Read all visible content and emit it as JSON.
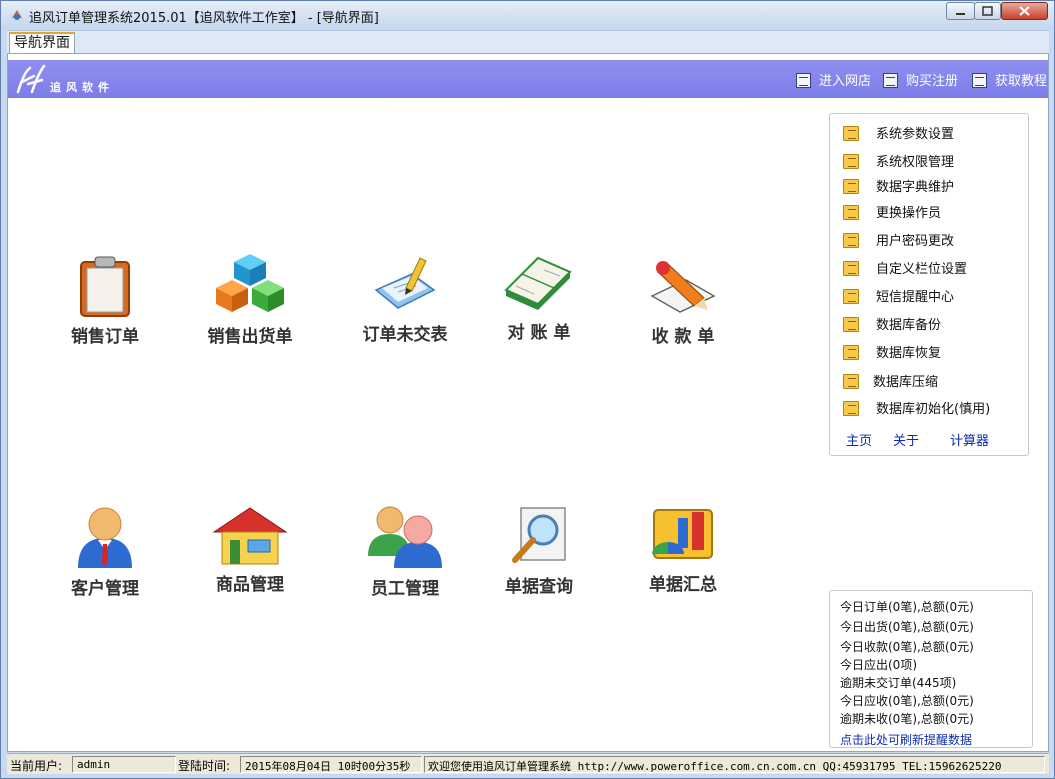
{
  "window": {
    "title": "追风订单管理系统2015.01【追风软件工作室】 - [导航界面]"
  },
  "tabs": [
    {
      "label": "导航界面"
    }
  ],
  "banner": {
    "logo_text": "追风软件",
    "links": [
      {
        "label": "进入网店"
      },
      {
        "label": "购买注册"
      },
      {
        "label": "获取教程"
      }
    ]
  },
  "modules": [
    {
      "label": "销售订单",
      "icon": "clipboard-icon"
    },
    {
      "label": "销售出货单",
      "icon": "cubes-icon"
    },
    {
      "label": "订单未交表",
      "icon": "note-pencil-icon"
    },
    {
      "label": "对 账 单",
      "icon": "open-book-icon"
    },
    {
      "label": "收 款 单",
      "icon": "pen-paper-icon"
    },
    {
      "label": "客户管理",
      "icon": "customer-icon"
    },
    {
      "label": "商品管理",
      "icon": "house-icon"
    },
    {
      "label": "员工管理",
      "icon": "staff-icon"
    },
    {
      "label": "单据查询",
      "icon": "magnifier-icon"
    },
    {
      "label": "单据汇总",
      "icon": "summary-chart-icon"
    }
  ],
  "settings": {
    "items": [
      {
        "label": "系统参数设置"
      },
      {
        "label": "系统权限管理"
      },
      {
        "label": "数据字典维护"
      },
      {
        "label": "更换操作员"
      },
      {
        "label": "用户密码更改"
      },
      {
        "label": "自定义栏位设置"
      },
      {
        "label": "短信提醒中心"
      },
      {
        "label": "数据库备份"
      },
      {
        "label": "数据库恢复"
      },
      {
        "label": "数据库压缩"
      },
      {
        "label": "数据库初始化(慎用)"
      }
    ],
    "links": [
      {
        "label": "主页"
      },
      {
        "label": "关于"
      },
      {
        "label": "计算器"
      }
    ]
  },
  "reminders": {
    "lines": [
      "今日订单(0笔),总额(0元)",
      "今日出货(0笔),总额(0元)",
      "今日收款(0笔),总额(0元)",
      "今日应出(0项)",
      "逾期未交订单(445项)",
      "今日应收(0笔),总额(0元)",
      "逾期未收(0笔),总额(0元)"
    ],
    "refresh_label": "点击此处可刷新提醒数据"
  },
  "statusbar": {
    "user_label": "当前用户:",
    "user_value": "admin",
    "login_label": "登陆时间:",
    "login_value": "2015年08月04日 10时00分35秒",
    "message": "欢迎您使用追风订单管理系统 http://www.poweroffice.com.cn.com.cn QQ:45931795 TEL:15962625220"
  },
  "colors": {
    "banner": "#8485ec",
    "link": "#0d2bb0",
    "tab_accent": "#e3a52b"
  }
}
